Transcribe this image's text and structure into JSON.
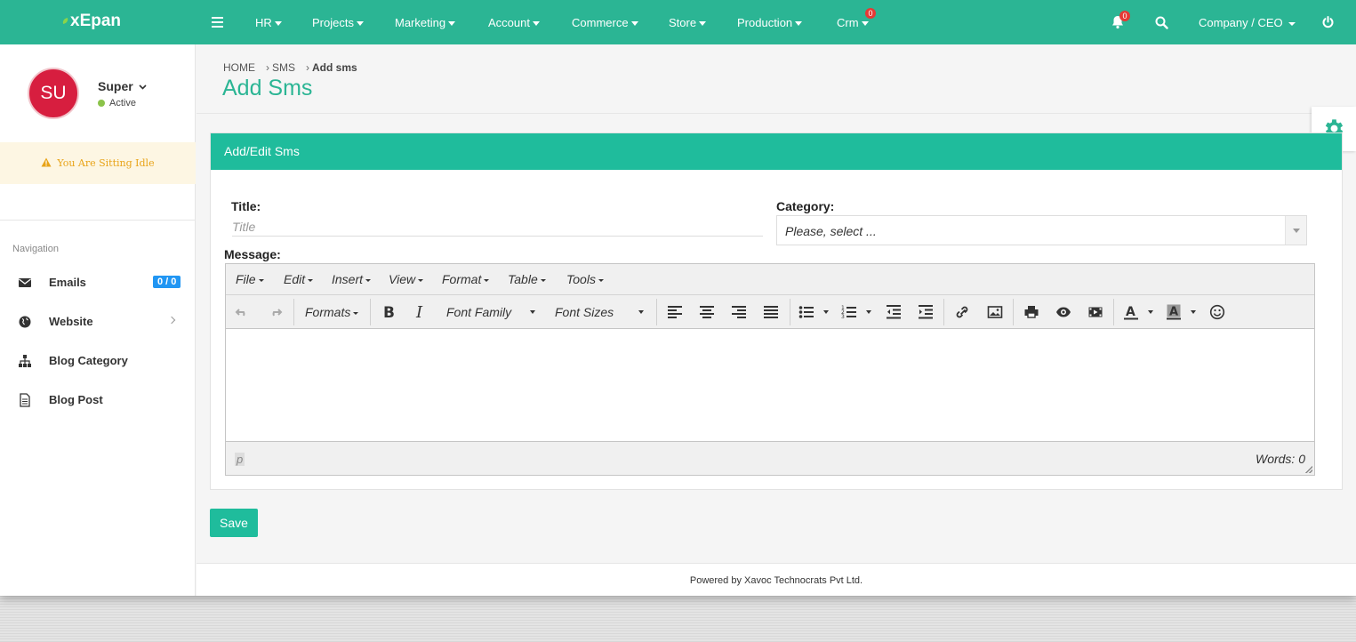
{
  "brand": "xEpan",
  "colors": {
    "primary": "#2bb594",
    "panel_header": "#1fbc9c",
    "avatar": "#d71e3f",
    "badge": "#e53935",
    "info_badge": "#2196f3",
    "warning": "#e8a317"
  },
  "topnav": {
    "items": [
      {
        "label": "HR"
      },
      {
        "label": "Projects"
      },
      {
        "label": "Marketing"
      },
      {
        "label": "Account"
      },
      {
        "label": "Commerce"
      },
      {
        "label": "Store"
      },
      {
        "label": "Production"
      },
      {
        "label": "Crm",
        "badge": "0"
      }
    ],
    "notifications_badge": "0",
    "company": "Company / CEO",
    "icons": [
      "menu-icon",
      "bell-icon",
      "search-icon",
      "power-icon"
    ]
  },
  "sidebar": {
    "avatar_initials": "SU",
    "user_name": "Super",
    "user_status": "Active",
    "idle_message": "You Are Sitting Idle",
    "nav_heading": "Navigation",
    "items": [
      {
        "label": "Emails",
        "badge": "0 / 0",
        "icon": "envelope-icon"
      },
      {
        "label": "Website",
        "icon": "globe-icon"
      },
      {
        "label": "Blog Category",
        "icon": "sitemap-icon"
      },
      {
        "label": "Blog Post",
        "icon": "file-text-icon"
      }
    ]
  },
  "breadcrumb": {
    "home": "HOME",
    "level1": "SMS",
    "current": "Add sms"
  },
  "page_title": "Add Sms",
  "panel": {
    "title": "Add/Edit Sms",
    "title_label": "Title:",
    "title_placeholder": "Title",
    "title_value": "",
    "category_label": "Category:",
    "category_value": "Please, select ...",
    "message_label": "Message:"
  },
  "editor": {
    "menus": [
      "File",
      "Edit",
      "Insert",
      "View",
      "Format",
      "Table",
      "Tools"
    ],
    "formats_label": "Formats",
    "font_family_label": "Font Family",
    "font_sizes_label": "Font Sizes",
    "path": "p",
    "word_count": "Words: 0"
  },
  "save_label": "Save",
  "footer": "Powered by Xavoc Technocrats Pvt Ltd."
}
